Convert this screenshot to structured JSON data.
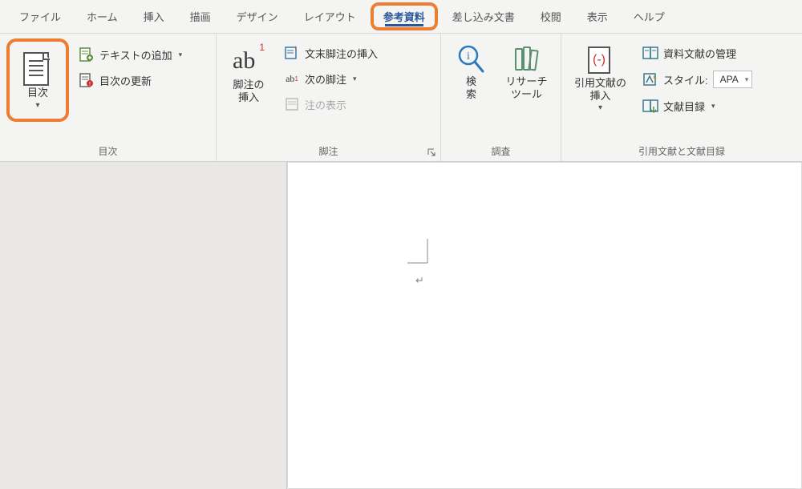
{
  "menu": {
    "items": [
      "ファイル",
      "ホーム",
      "挿入",
      "描画",
      "デザイン",
      "レイアウト",
      "参考資料",
      "差し込み文書",
      "校閲",
      "表示",
      "ヘルプ"
    ],
    "activeIndex": 6
  },
  "ribbon": {
    "groups": {
      "toc": {
        "label": "目次",
        "toc_button": "目次",
        "add_text": "テキストの追加",
        "update": "目次の更新"
      },
      "footnotes": {
        "label": "脚注",
        "insert_footnote": "脚注の\n挿入",
        "ab_badge": "1",
        "insert_endnote": "文末脚注の挿入",
        "next_footnote": "次の脚注",
        "show_notes": "注の表示"
      },
      "research": {
        "label": "調査",
        "search": "検\n索",
        "researcher": "リサーチ\nツール"
      },
      "citations": {
        "label": "引用文献と文献目録",
        "insert_citation": "引用文献の\n挿入",
        "manage_sources": "資料文献の管理",
        "style_label": "スタイル:",
        "style_value": "APA",
        "bibliography": "文献目録"
      }
    }
  }
}
